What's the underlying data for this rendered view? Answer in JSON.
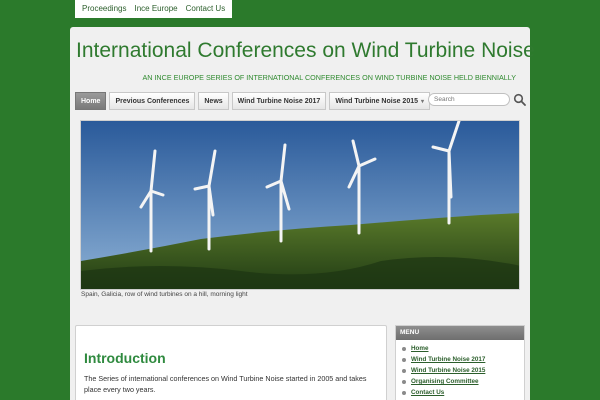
{
  "topbar": {
    "links": [
      "Proceedings",
      "Ince Europe",
      "Contact Us"
    ]
  },
  "header": {
    "title": "International Conferences on Wind Turbine Noise",
    "tagline": "An INCE Europe series of international conferences on Wind Turbine Noise held biennially"
  },
  "nav": {
    "items": [
      "Home",
      "Previous Conferences",
      "News",
      "Wind Turbine Noise 2017",
      "Wind Turbine Noise 2015"
    ],
    "active": "Home"
  },
  "search": {
    "placeholder": "Search"
  },
  "banner": {
    "caption": "Spain, Galicia, row of wind turbines on a hill, morning light"
  },
  "content": {
    "heading": "Introduction",
    "text": "The Series of international conferences on Wind  Turbine Noise started in 2005 and takes place every two years."
  },
  "sidebar": {
    "title": "Menu",
    "items": [
      "Home",
      "Wind Turbine Noise 2017",
      "Wind Turbine Noise 2015",
      "Organising Committee",
      "Contact Us"
    ]
  },
  "colors": {
    "page_bg": "#2b7a2b",
    "accent": "#2f7a2f",
    "heading": "#2f8a3f"
  }
}
